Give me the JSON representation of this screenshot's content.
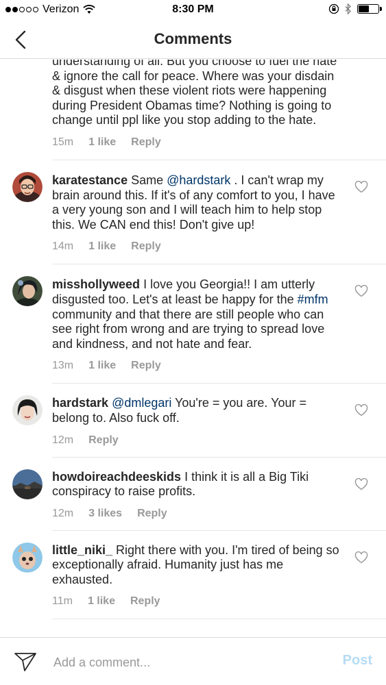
{
  "status_bar": {
    "carrier": "Verizon",
    "time": "8:30 PM",
    "signal_bars_filled": 2,
    "signal_bars_total": 5,
    "battery_level": 0.55
  },
  "header": {
    "title": "Comments",
    "back_icon": "chevron-left-icon"
  },
  "comments": [
    {
      "username": "",
      "text_parts": [
        {
          "t": "understanding of all. But you choose to fuel the hate & ignore the call for peace. Where was your disdain & disgust when these violent riots were happening during President Obamas time?  Nothing is going to change until ppl like you stop adding to the hate.",
          "mention": false
        }
      ],
      "time": "15m",
      "likes": "1 like",
      "reply": "Reply"
    },
    {
      "username": "karatestance",
      "text_parts": [
        {
          "t": " Same ",
          "mention": false
        },
        {
          "t": "@hardstark",
          "mention": true
        },
        {
          "t": " . I can't wrap my brain around this. If it's of any comfort to you, I have a very young son and I will teach him to help stop this. We CAN end this! Don't give up!",
          "mention": false
        }
      ],
      "time": "14m",
      "likes": "1 like",
      "reply": "Reply"
    },
    {
      "username": "misshollyweed",
      "text_parts": [
        {
          "t": " I love you Georgia!! I am utterly disgusted too. Let's at least be happy for the ",
          "mention": false
        },
        {
          "t": "#mfm",
          "mention": true
        },
        {
          "t": " community and that there are still people who can see right from wrong and are trying to spread love and kindness, and not hate and fear.",
          "mention": false
        }
      ],
      "time": "13m",
      "likes": "1 like",
      "reply": "Reply"
    },
    {
      "username": "hardstark",
      "text_parts": [
        {
          "t": " ",
          "mention": false
        },
        {
          "t": "@dmlegari",
          "mention": true
        },
        {
          "t": " You're = you are. Your = belong to. Also fuck off.",
          "mention": false
        }
      ],
      "time": "12m",
      "likes": "",
      "reply": "Reply"
    },
    {
      "username": "howdoireachdeeskids",
      "text_parts": [
        {
          "t": " I think it is all a Big Tiki conspiracy to raise profits.",
          "mention": false
        }
      ],
      "time": "12m",
      "likes": "3 likes",
      "reply": "Reply"
    },
    {
      "username": "little_niki_",
      "text_parts": [
        {
          "t": " Right there with you. I'm tired of being so exceptionally afraid. Humanity just has me exhausted.",
          "mention": false
        }
      ],
      "time": "11m",
      "likes": "1 like",
      "reply": "Reply"
    }
  ],
  "footer": {
    "placeholder": "Add a comment...",
    "post_label": "Post",
    "send_icon": "direct-send-icon"
  },
  "colors": {
    "text": "#262626",
    "meta": "#999999",
    "mention": "#003569",
    "post_disabled": "#b6dcf5",
    "divider": "#e6e6e6"
  }
}
